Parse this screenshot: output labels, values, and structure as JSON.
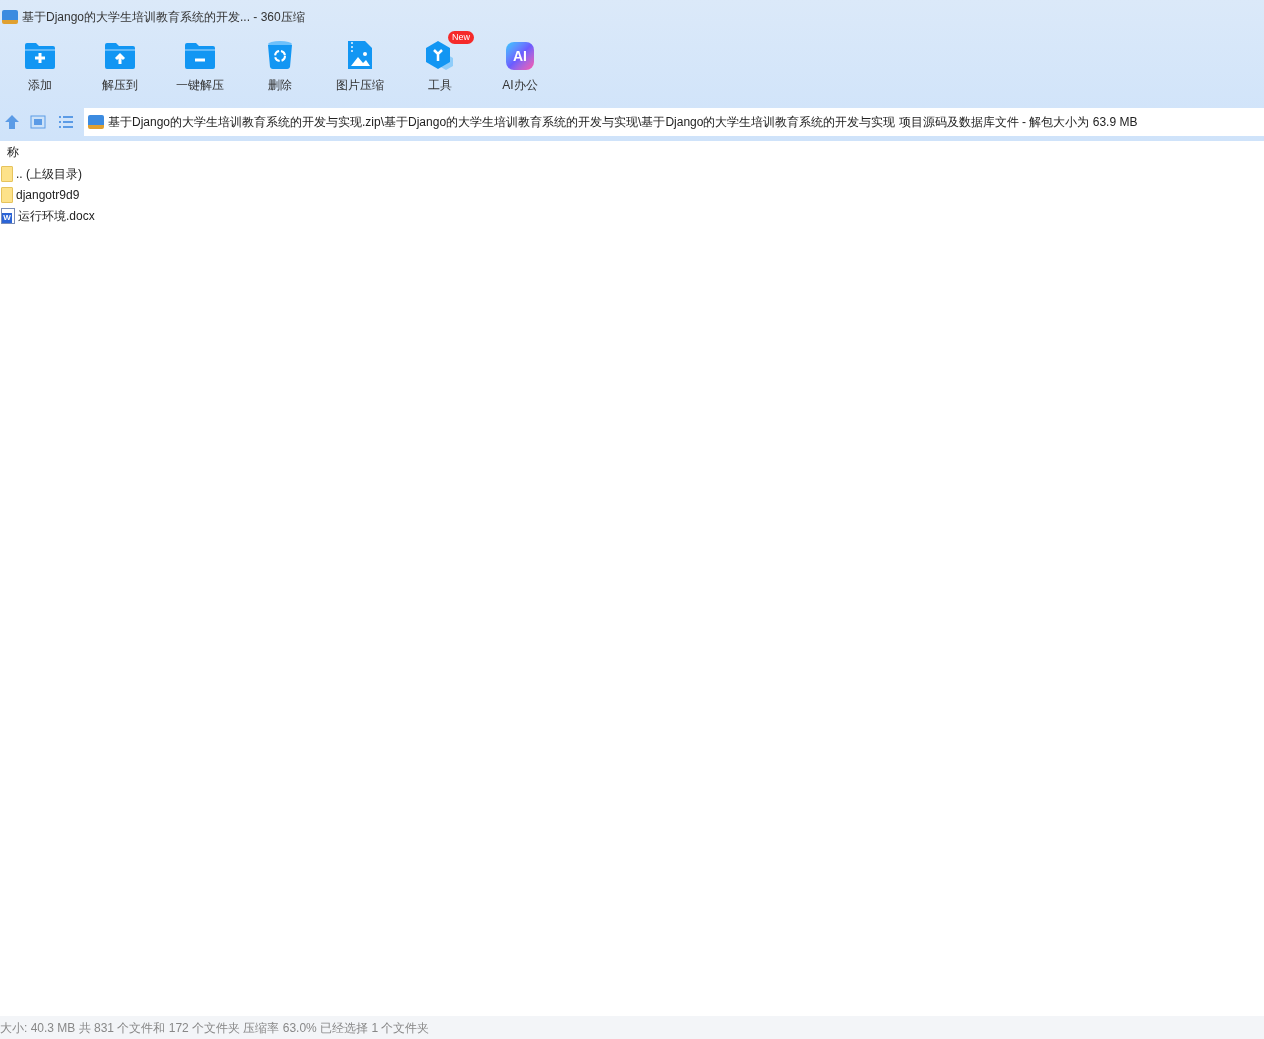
{
  "window": {
    "title": "基于Django的大学生培训教育系统的开发... - 360压缩"
  },
  "toolbar": [
    {
      "kind": "add",
      "label": "添加"
    },
    {
      "kind": "extract-to",
      "label": "解压到"
    },
    {
      "kind": "extract",
      "label": "一键解压"
    },
    {
      "kind": "delete",
      "label": "删除"
    },
    {
      "kind": "image",
      "label": "图片压缩"
    },
    {
      "kind": "tools",
      "label": "工具",
      "badge": "New"
    },
    {
      "kind": "ai",
      "label": "AI办公",
      "icon_text": "AI"
    }
  ],
  "address": {
    "path": "基于Django的大学生培训教育系统的开发与实现.zip\\基于Django的大学生培训教育系统的开发与实现\\基于Django的大学生培训教育系统的开发与实现 项目源码及数据库文件 - 解包大小为 63.9 MB"
  },
  "table": {
    "columns": [
      "称"
    ],
    "rows": [
      {
        "kind": "folder",
        "name": ".. (上级目录)"
      },
      {
        "kind": "folder",
        "name": "djangotr9d9"
      },
      {
        "kind": "docx",
        "name": "运行环境.docx",
        "icon_text": "W"
      }
    ]
  },
  "status_bar": "大小: 40.3 MB 共 831 个文件和 172 个文件夹 压缩率 63.0% 已经选择 1 个文件夹"
}
